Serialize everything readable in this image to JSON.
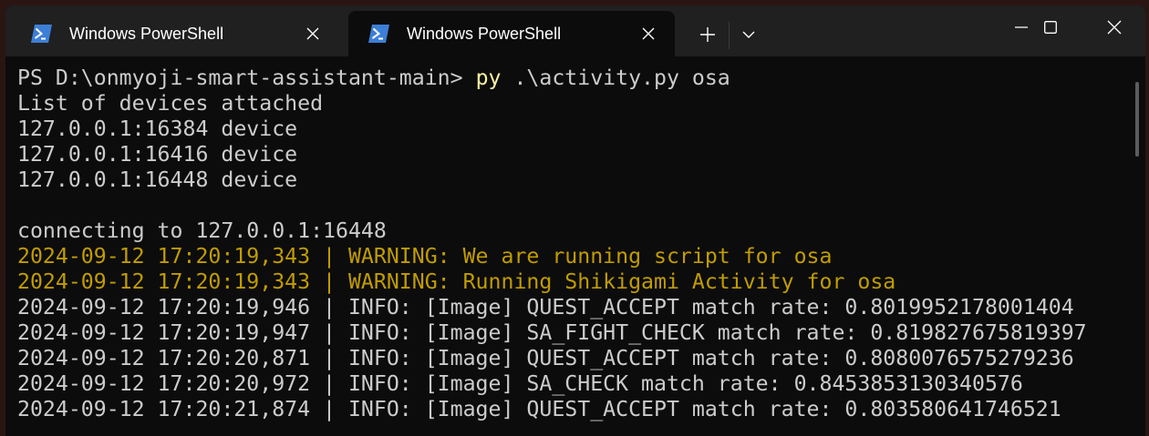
{
  "tabs": [
    {
      "title": "Windows PowerShell",
      "active": false
    },
    {
      "title": "Windows PowerShell",
      "active": true
    }
  ],
  "icons": {
    "tab_icon": "powershell-icon",
    "tab_close": "close-icon",
    "new_tab": "plus-icon",
    "dropdown": "chevron-down-icon",
    "minimize": "minimize-icon",
    "maximize": "maximize-icon",
    "close": "close-icon"
  },
  "colors": {
    "background": "#0c0c0c",
    "text": "#cccccc",
    "warning": "#c19c00",
    "command": "#f9f1a5"
  },
  "terminal": {
    "prompt": "PS D:\\onmyoji-smart-assistant-main> ",
    "command_exe": "py",
    "command_args": " .\\activity.py osa",
    "lines": [
      "List of devices attached",
      "127.0.0.1:16384 device",
      "127.0.0.1:16416 device",
      "127.0.0.1:16448 device",
      "",
      "connecting to 127.0.0.1:16448"
    ],
    "warnings": [
      "2024-09-12 17:20:19,343 | WARNING: We are running script for osa",
      "2024-09-12 17:20:19,343 | WARNING: Running Shikigami Activity for osa"
    ],
    "info": [
      "2024-09-12 17:20:19,946 | INFO: [Image] QUEST_ACCEPT match rate: 0.8019952178001404",
      "2024-09-12 17:20:19,947 | INFO: [Image] SA_FIGHT_CHECK match rate: 0.819827675819397",
      "2024-09-12 17:20:20,871 | INFO: [Image] QUEST_ACCEPT match rate: 0.8080076575279236",
      "2024-09-12 17:20:20,972 | INFO: [Image] SA_CHECK match rate: 0.8453853130340576",
      "2024-09-12 17:20:21,874 | INFO: [Image] QUEST_ACCEPT match rate: 0.803580641746521"
    ]
  }
}
